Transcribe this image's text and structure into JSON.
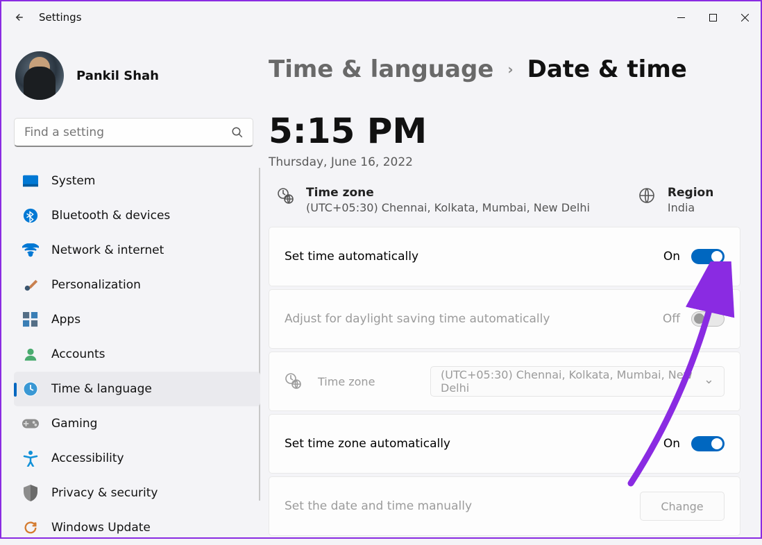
{
  "titlebar": {
    "app_title": "Settings"
  },
  "profile": {
    "name": "Pankil Shah"
  },
  "search": {
    "placeholder": "Find a setting"
  },
  "nav": {
    "items": [
      "System",
      "Bluetooth & devices",
      "Network & internet",
      "Personalization",
      "Apps",
      "Accounts",
      "Time & language",
      "Gaming",
      "Accessibility",
      "Privacy & security",
      "Windows Update"
    ]
  },
  "breadcrumb": {
    "parent": "Time & language",
    "current": "Date & time"
  },
  "clock": {
    "time": "5:15 PM",
    "date": "Thursday, June 16, 2022"
  },
  "summary": {
    "tz_label": "Time zone",
    "tz_value": "(UTC+05:30) Chennai, Kolkata, Mumbai, New Delhi",
    "region_label": "Region",
    "region_value": "India"
  },
  "cards": {
    "auto_time": {
      "label": "Set time automatically",
      "state_text": "On"
    },
    "dst": {
      "label": "Adjust for daylight saving time automatically",
      "state_text": "Off"
    },
    "timezone": {
      "label": "Time zone",
      "selected": "(UTC+05:30) Chennai, Kolkata, Mumbai, New Delhi"
    },
    "auto_tz": {
      "label": "Set time zone automatically",
      "state_text": "On"
    },
    "manual": {
      "label": "Set the date and time manually",
      "button": "Change"
    }
  }
}
